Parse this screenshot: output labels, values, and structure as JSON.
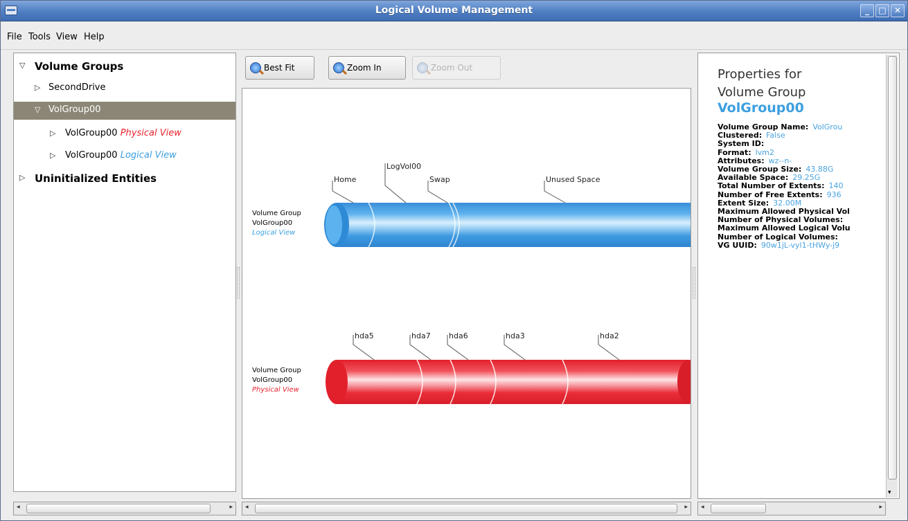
{
  "window": {
    "title": "Logical Volume Management"
  },
  "menu": {
    "file": "File",
    "tools": "Tools",
    "view": "View",
    "help": "Help"
  },
  "tree": {
    "volume_groups": "Volume Groups",
    "second_drive": "SecondDrive",
    "volgroup": "VolGroup00",
    "physical_item_name": "VolGroup00",
    "physical_item_view": "Physical View",
    "logical_item_name": "VolGroup00",
    "logical_item_view": "Logical View",
    "uninitialized": "Uninitialized Entities"
  },
  "toolbar": {
    "best_fit": "Best Fit",
    "zoom_in": "Zoom In",
    "zoom_out": "Zoom Out"
  },
  "logical_view": {
    "line1": "Volume Group",
    "line2": "VolGroup00",
    "line3": "Logical View",
    "labels": [
      "Home",
      "LogVol00",
      "Swap",
      "Unused Space"
    ],
    "color": "#3c9fdf"
  },
  "physical_view": {
    "line1": "Volume Group",
    "line2": "VolGroup00",
    "line3": "Physical View",
    "labels": [
      "hda5",
      "hda7",
      "hda6",
      "hda3",
      "hda2"
    ],
    "color": "#e8232e"
  },
  "properties": {
    "heading_line1": "Properties for",
    "heading_line2": "Volume Group",
    "name": "VolGroup00",
    "rows": [
      {
        "key": "Volume Group Name:",
        "value": "VolGrou"
      },
      {
        "key": "Clustered:",
        "value": "False"
      },
      {
        "key": "System ID:",
        "value": ""
      },
      {
        "key": "Format:",
        "value": "lvm2"
      },
      {
        "key": "Attributes:",
        "value": "wz--n-"
      },
      {
        "key": "Volume Group Size:",
        "value": "43.88G"
      },
      {
        "key": "Available Space:",
        "value": "29.25G"
      },
      {
        "key": "Total Number of Extents:",
        "value": "140"
      },
      {
        "key": "Number of Free Extents:",
        "value": "936"
      },
      {
        "key": "Extent Size:",
        "value": "32.00M"
      },
      {
        "key": "Maximum Allowed Physical Vol",
        "value": ""
      },
      {
        "key": "Number of Physical Volumes:",
        "value": ""
      },
      {
        "key": "Maximum Allowed Logical Volu",
        "value": ""
      },
      {
        "key": "Number of Logical Volumes:",
        "value": ""
      },
      {
        "key": "VG UUID:",
        "value": "90w1jL-vyl1-tHWy-j9"
      }
    ]
  }
}
